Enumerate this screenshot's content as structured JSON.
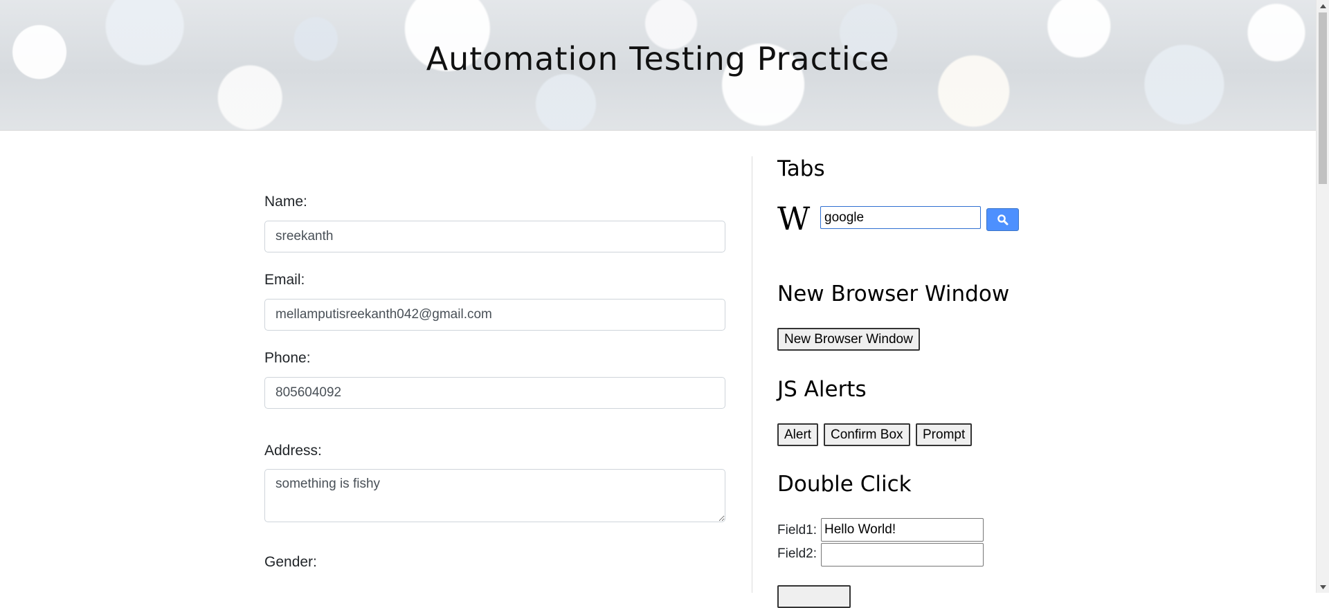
{
  "header": {
    "title": "Automation Testing Practice"
  },
  "form": {
    "name": {
      "label": "Name:",
      "value": "sreekanth"
    },
    "email": {
      "label": "Email:",
      "value": "mellamputisreekanth042@gmail.com"
    },
    "phone": {
      "label": "Phone:",
      "value": "805604092"
    },
    "address": {
      "label": "Address:",
      "value": "something is fishy"
    },
    "gender": {
      "label": "Gender:"
    }
  },
  "tabs": {
    "title": "Tabs",
    "wiki_logo": "W",
    "search_value": "google",
    "search_icon": "search-icon"
  },
  "new_window": {
    "title": "New Browser Window",
    "button_label": "New Browser Window"
  },
  "js_alerts": {
    "title": "JS Alerts",
    "alert_label": "Alert",
    "confirm_label": "Confirm Box",
    "prompt_label": "Prompt"
  },
  "double_click": {
    "title": "Double Click",
    "field1_label": "Field1:",
    "field1_value": "Hello World!",
    "field2_label": "Field2:",
    "field2_value": ""
  },
  "colors": {
    "search_button": "#4d90fe",
    "input_focus_border": "#2e6fd1",
    "scroll_thumb": "#c1c1c1"
  }
}
